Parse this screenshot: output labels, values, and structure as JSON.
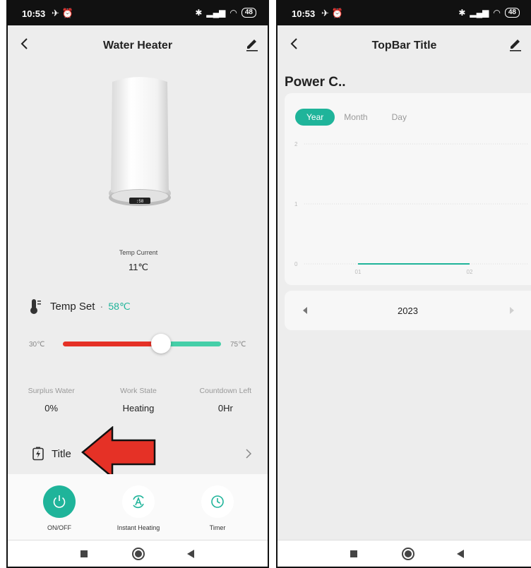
{
  "left_screen": {
    "status": {
      "time": "10:53",
      "battery": "48"
    },
    "nav": {
      "title": "Water Heater"
    },
    "temp_current": {
      "label": "Temp Current",
      "value": "11℃"
    },
    "temp_set": {
      "label": "Temp Set",
      "separator": "·",
      "value": "58℃"
    },
    "slider": {
      "min_label": "30℃",
      "max_label": "75℃",
      "value": 58,
      "min": 30,
      "max": 75
    },
    "stats": [
      {
        "label": "Surplus Water",
        "value": "0%"
      },
      {
        "label": "Work State",
        "value": "Heating"
      },
      {
        "label": "Countdown Left",
        "value": "0Hr"
      }
    ],
    "title_row": {
      "label": "Title"
    },
    "controls": [
      {
        "label": "ON/OFF",
        "icon": "power-icon"
      },
      {
        "label": "Instant Heating",
        "icon": "instant-heating-icon"
      },
      {
        "label": "Timer",
        "icon": "clock-icon"
      }
    ],
    "annotation": {
      "icon": "red-arrow-icon",
      "color": "#e53126"
    }
  },
  "right_screen": {
    "status": {
      "time": "10:53",
      "battery": "48"
    },
    "nav": {
      "title": "TopBar Title"
    },
    "section_title": "Power C..",
    "tabs": [
      "Year",
      "Month",
      "Day"
    ],
    "active_tab": "Year",
    "year_selector": {
      "year": "2023"
    },
    "chart_data": {
      "type": "line",
      "x": [
        "01",
        "02"
      ],
      "series": [
        {
          "values": [
            0,
            0
          ]
        }
      ],
      "y_ticks": [
        "2",
        "1",
        "0"
      ],
      "ylim": [
        0,
        2
      ],
      "grid": true,
      "color": "#1fb49a"
    }
  },
  "colors": {
    "accent": "#1fb49a",
    "slider_low": "#e53126",
    "slider_high": "#45cfa8"
  }
}
